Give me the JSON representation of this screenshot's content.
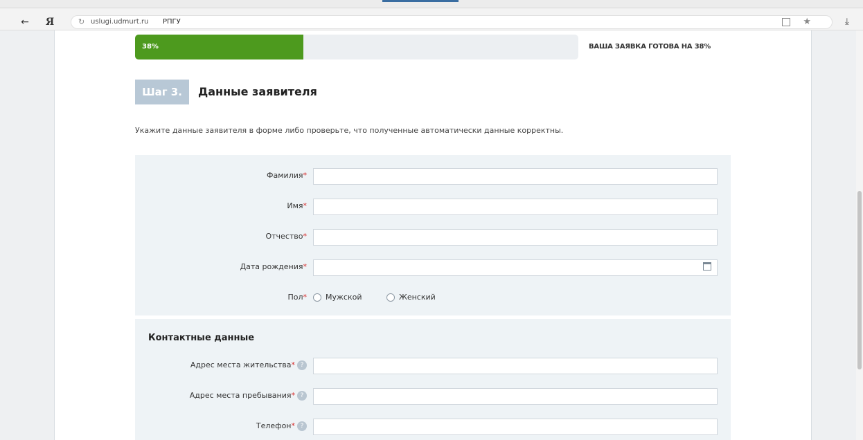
{
  "browser": {
    "back_icon": "arrow-left-icon",
    "logo_text": "Я",
    "url_host": "uslugi.udmurt.ru",
    "page_title": "РПГУ",
    "reload_icon": "reload-icon",
    "star_icon": "star-icon",
    "download_icon": "download-icon"
  },
  "progress": {
    "percent": 38,
    "label": "38%",
    "status_text": "ВАША ЗАЯВКА ГОТОВА НА 38%",
    "fill_color": "#4d9a1e"
  },
  "step": {
    "badge": "Шаг 3.",
    "title": "Данные заявителя",
    "intro": "Укажите данные заявителя в форме либо проверьте, что полученные автоматически данные корректны."
  },
  "personal": {
    "fields": [
      {
        "label": "Фамилия",
        "required": "*",
        "value": ""
      },
      {
        "label": "Имя",
        "required": "*",
        "value": ""
      },
      {
        "label": "Отчество",
        "required": "*",
        "value": ""
      },
      {
        "label": "Дата рождения",
        "required": "*",
        "value": ""
      }
    ],
    "gender": {
      "label": "Пол",
      "required": "*",
      "options": [
        "Мужской",
        "Женский"
      ]
    }
  },
  "contacts": {
    "heading": "Контактные данные",
    "fields": [
      {
        "label": "Адрес места жительства",
        "required": "*",
        "value": ""
      },
      {
        "label": "Адрес места пребывания",
        "required": "*",
        "value": ""
      },
      {
        "label": "Телефон",
        "required": "*",
        "value": ""
      }
    ]
  }
}
